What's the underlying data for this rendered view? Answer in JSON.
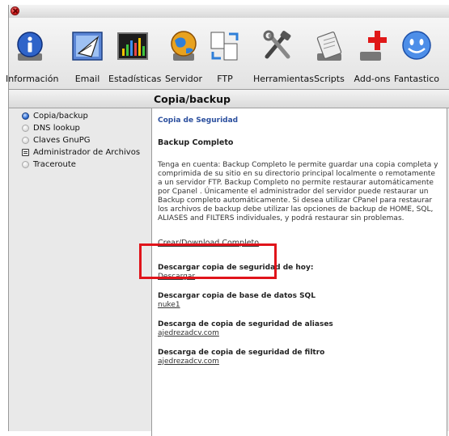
{
  "toolbar": {
    "items": [
      {
        "label": "Información",
        "icon": "info-icon"
      },
      {
        "label": "Email",
        "icon": "email-icon"
      },
      {
        "label": "Estadísticas",
        "icon": "stats-icon"
      },
      {
        "label": "Servidor",
        "icon": "server-globe-icon"
      },
      {
        "label": "FTP",
        "icon": "ftp-icon"
      },
      {
        "label": "Herramientas",
        "icon": "tools-icon"
      },
      {
        "label": "Scripts",
        "icon": "scripts-icon"
      },
      {
        "label": "Add-ons",
        "icon": "add-ons-icon"
      },
      {
        "label": "Fantastico",
        "icon": "smiley-icon"
      }
    ]
  },
  "section": {
    "title": "Copia/backup"
  },
  "sidebar": {
    "items": [
      {
        "label": "Copia/backup",
        "state": "active"
      },
      {
        "label": "DNS lookup",
        "state": "inactive"
      },
      {
        "label": "Claves GnuPG",
        "state": "inactive"
      },
      {
        "label": "Administrador de Archivos",
        "state": "doc"
      },
      {
        "label": "Traceroute",
        "state": "inactive"
      }
    ]
  },
  "content": {
    "heading": "Copia de Seguridad",
    "subheading": "Backup Completo",
    "paragraph": "Tenga en cuenta: Backup Completo le permite guardar una copia completa y comprimida de su sitio en su directorio principal localmente o remotamente a un servidor FTP. Backup Completo no permite restaurar automáticamente por Cpanel . Únicamente el administrador del servidor puede restaurar un Backup completo automáticamente. Si desea utilizar CPanel para restaurar los archivos de backup debe utilizar las opciones de backup de HOME, SQL, ALIASES and FILTERS individuales, y podrá restaurar sin problemas.",
    "create_link": "Crear/Download Completo",
    "blocks": [
      {
        "label": "Descargar copia de seguridad de hoy:",
        "link": "Descargar"
      },
      {
        "label": "Descargar copia de base de datos SQL",
        "link": "nuke1"
      },
      {
        "label": "Descarga de copia de seguridad de aliases",
        "link": "ajedrezadcv.com"
      },
      {
        "label": "Descarga de copia de seguridad de filtro",
        "link": "ajedrezadcv.com"
      }
    ]
  },
  "colors": {
    "highlight": "#e0141b",
    "link": "#2b4f9e"
  }
}
